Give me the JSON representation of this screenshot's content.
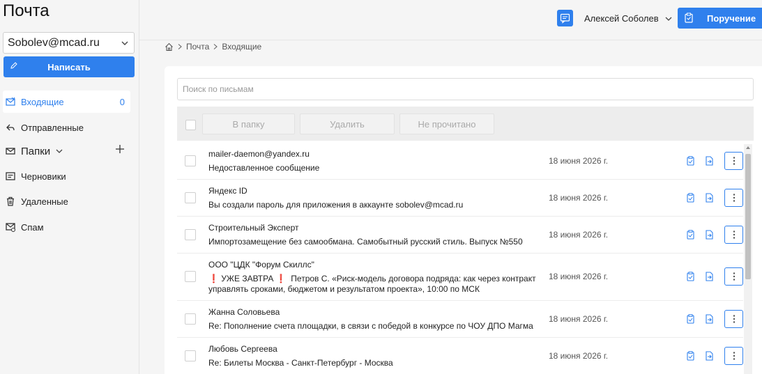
{
  "app": {
    "title": "Почта"
  },
  "account": {
    "email": "Sobolev@mcad.ru"
  },
  "compose": {
    "label": "Написать"
  },
  "nav": {
    "inbox": {
      "label": "Входящие",
      "count": "0"
    },
    "sent": {
      "label": "Отправленные"
    },
    "folders": {
      "label": "Папки"
    },
    "drafts": {
      "label": "Черновики"
    },
    "deleted": {
      "label": "Удаленные"
    },
    "spam": {
      "label": "Спам"
    }
  },
  "header": {
    "user_name": "Алексей Соболев",
    "task_button": "Поручение"
  },
  "breadcrumb": {
    "item1": "Почта",
    "item2": "Входящие"
  },
  "search": {
    "placeholder": "Поиск по письмам"
  },
  "toolbar": {
    "to_folder": "В папку",
    "delete": "Удалить",
    "unread": "Не прочитано"
  },
  "messages": [
    {
      "sender": "mailer-daemon@yandex.ru",
      "subject": "Недоставленное сообщение",
      "date": "18 июня 2026 г."
    },
    {
      "sender": "Яндекс ID",
      "subject": "Вы создали пароль для приложения в аккаунте sobolev@mcad.ru",
      "date": "18 июня 2026 г."
    },
    {
      "sender": "Строительный Эксперт",
      "subject": "Импортозамещение без самообмана. Самобытный русский стиль. Выпуск №550",
      "date": "18 июня 2026 г."
    },
    {
      "sender": "ООО \"ЦДК \"Форум Скиллс\"",
      "subject_mark": "❗",
      "subject_a": "УЖЕ ЗАВТРА",
      "subject_b": "Петров С. «Риск-модель договора подряда: как через контракт управлять сроками, бюджетом и результатом проекта», 10:00 по МСК",
      "date": "18 июня 2026 г."
    },
    {
      "sender": "Жанна Соловьева",
      "subject": "Re: Пополнение счета площадки, в связи с победой в конкурсе по ЧОУ ДПО Магма",
      "date": "18 июня 2026 г."
    },
    {
      "sender": "Любовь Сергеева",
      "subject": "Re: Билеты Москва - Санкт-Петербург - Москва",
      "date": "18 июня 2026 г."
    }
  ],
  "colors": {
    "accent": "#2f80ed",
    "background": "#f5f5f5",
    "panel": "#ffffff"
  }
}
